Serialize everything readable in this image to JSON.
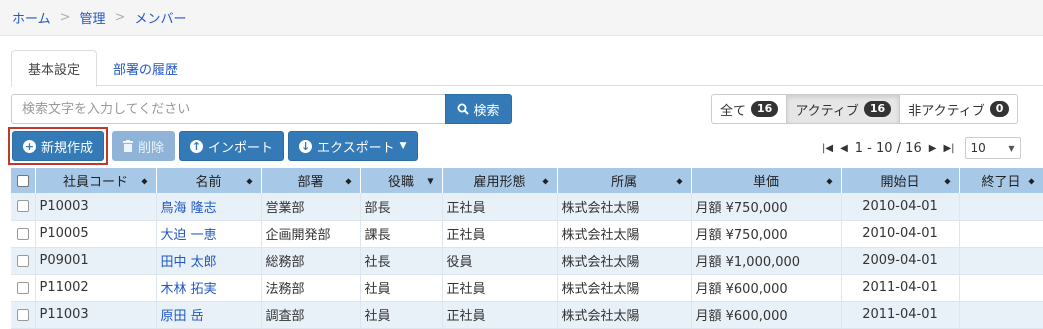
{
  "breadcrumb": {
    "items": [
      "ホーム",
      "管理"
    ],
    "current": "メンバー",
    "separator": ">"
  },
  "tabs": [
    {
      "label": "基本設定"
    },
    {
      "label": "部署の履歴"
    }
  ],
  "search": {
    "placeholder": "検索文字を入力してください",
    "button_label": "検索"
  },
  "filters": [
    {
      "label": "全て",
      "count": "16"
    },
    {
      "label": "アクティブ",
      "count": "16"
    },
    {
      "label": "非アクティブ",
      "count": "0"
    }
  ],
  "actions": {
    "create": "新規作成",
    "delete": "削除",
    "import": "インポート",
    "export": "エクスポート"
  },
  "pager": {
    "range": "1 - 10 / 16",
    "page_size": "10"
  },
  "table": {
    "columns": [
      "社員コード",
      "名前",
      "部署",
      "役職",
      "雇用形態",
      "所属",
      "単価",
      "開始日",
      "終了日"
    ],
    "rows": [
      {
        "code": "P10003",
        "name": "鳥海 隆志",
        "dept": "営業部",
        "title": "部長",
        "employment": "正社員",
        "affiliation": "株式会社太陽",
        "rate": "月額 ¥750,000",
        "start": "2010-04-01",
        "end": ""
      },
      {
        "code": "P10005",
        "name": "大迫 一恵",
        "dept": "企画開発部",
        "title": "課長",
        "employment": "正社員",
        "affiliation": "株式会社太陽",
        "rate": "月額 ¥750,000",
        "start": "2010-04-01",
        "end": ""
      },
      {
        "code": "P09001",
        "name": "田中 太郎",
        "dept": "総務部",
        "title": "社長",
        "employment": "役員",
        "affiliation": "株式会社太陽",
        "rate": "月額 ¥1,000,000",
        "start": "2009-04-01",
        "end": ""
      },
      {
        "code": "P11002",
        "name": "木林 拓実",
        "dept": "法務部",
        "title": "社員",
        "employment": "正社員",
        "affiliation": "株式会社太陽",
        "rate": "月額 ¥600,000",
        "start": "2011-04-01",
        "end": ""
      },
      {
        "code": "P11003",
        "name": "原田 岳",
        "dept": "調査部",
        "title": "社員",
        "employment": "正社員",
        "affiliation": "株式会社太陽",
        "rate": "月額 ¥600,000",
        "start": "2011-04-01",
        "end": ""
      }
    ]
  },
  "colors": {
    "primary": "#337ab7",
    "header_bg": "#a8c8e8",
    "row_alt": "#e8f0f8",
    "link": "#2258c4",
    "highlight": "#c0392b"
  },
  "icons": [
    "search-icon",
    "plus-circle-icon",
    "trash-icon",
    "import-icon",
    "export-icon",
    "caret-down-icon",
    "sort-icon",
    "first-page-icon",
    "prev-page-icon",
    "next-page-icon",
    "last-page-icon"
  ]
}
